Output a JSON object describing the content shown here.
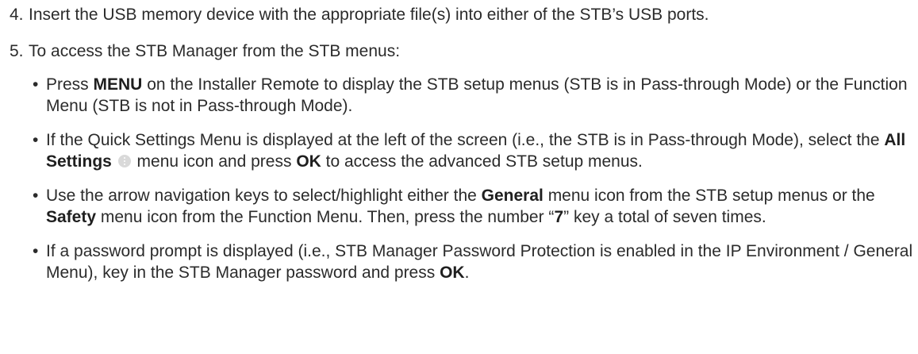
{
  "steps": [
    {
      "number": "4.",
      "text": "Insert the USB memory device with the appropriate file(s) into either of the STB’s USB ports."
    },
    {
      "number": "5.",
      "text": "To access the STB Manager from the STB menus:"
    }
  ],
  "bullet_symbol": "•",
  "bullets": {
    "b1": {
      "pre": "Press ",
      "bold1": "MENU",
      "post": " on the Installer Remote to display the STB setup menus (STB is in Pass-through Mode) or the Function Menu (STB is not in Pass-through Mode)."
    },
    "b2": {
      "pre": "If the Quick Settings Menu is displayed at the left of the screen (i.e., the STB is in Pass-through Mode), select the ",
      "bold1": "All Settings",
      "icon": "more-vertical-icon",
      "mid": " menu icon and press ",
      "bold2": "OK",
      "post": " to access the advanced STB setup menus."
    },
    "b3": {
      "pre": "Use the arrow navigation keys to select/highlight either the ",
      "bold1": "General",
      "mid": " menu icon from the STB setup menus or the ",
      "bold2": "Safety",
      "mid2": " menu icon from the Function Menu. Then, press the number “",
      "bold3": "7",
      "post": "” key a total of seven times."
    },
    "b4": {
      "pre": "If a password prompt is displayed (i.e., STB Manager Password Protection is enabled in the IP Environment / General Menu), key in the STB Manager password and press ",
      "bold1": "OK",
      "post": "."
    }
  }
}
